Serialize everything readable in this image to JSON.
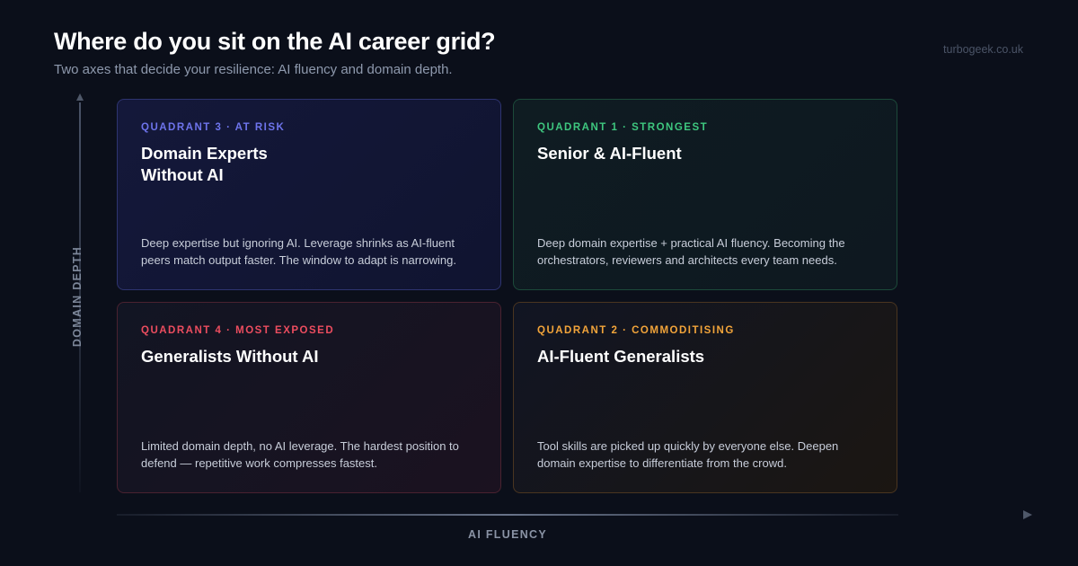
{
  "header": {
    "title": "Where do you sit on the AI career grid?",
    "subtitle": "Two axes that decide your resilience: AI fluency and domain depth.",
    "brand": "turbogeek.co.uk"
  },
  "axes": {
    "y_label": "DOMAIN DEPTH",
    "x_label": "AI FLUENCY"
  },
  "quadrants": {
    "q3": {
      "tag": "QUADRANT 3 · AT RISK",
      "title": "Domain Experts\nWithout AI",
      "body": "Deep expertise but ignoring AI. Leverage shrinks as AI-fluent peers match output faster. The window to adapt is narrowing.",
      "accent": "#6e74ec"
    },
    "q1": {
      "tag": "QUADRANT 1 · STRONGEST",
      "title": "Senior & AI-Fluent",
      "body": "Deep domain expertise + practical AI fluency. Becoming the orchestrators, reviewers and architects every team needs.",
      "accent": "#3ec77f"
    },
    "q4": {
      "tag": "QUADRANT 4 · MOST EXPOSED",
      "title": "Generalists Without AI",
      "body": "Limited domain depth, no AI leverage. The hardest position to defend — repetitive work compresses fastest.",
      "accent": "#ec4d5f"
    },
    "q2": {
      "tag": "QUADRANT 2 · COMMODITISING",
      "title": "AI-Fluent Generalists",
      "body": "Tool skills are picked up quickly by everyone else. Deepen domain expertise to differentiate from the crowd.",
      "accent": "#f2a43a"
    }
  },
  "icons": {
    "y_arrow": "arrow-up-icon",
    "x_arrow": "arrow-right-icon"
  }
}
